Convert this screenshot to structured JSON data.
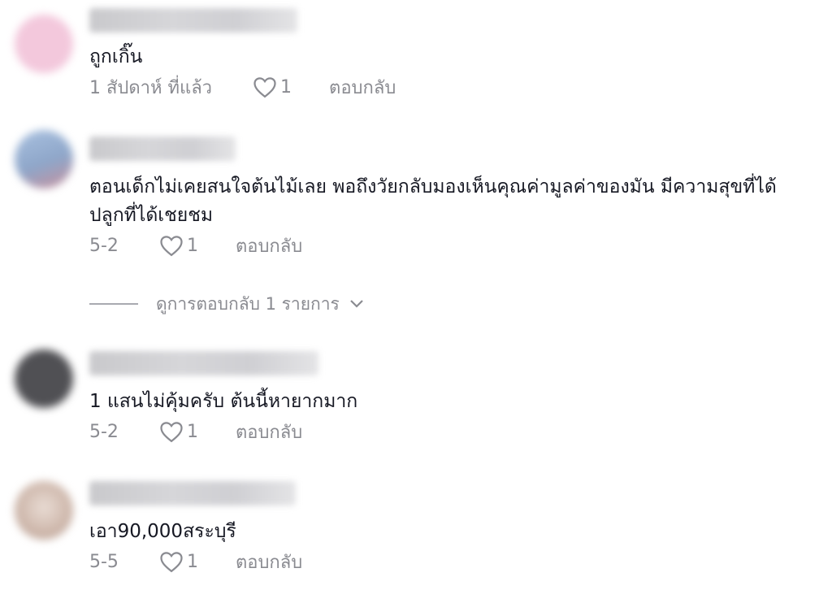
{
  "comments": [
    {
      "text": "ถูกเกิ๊น",
      "time": "1 สัปดาห์ ที่แล้ว",
      "likes": "1",
      "reply_label": "ตอบกลับ",
      "avatar_color": "#f3c8dc"
    },
    {
      "text_line1": "ตอนเด็กไม่เคยสนใจต้นไม้เลย พอถึงวัยกลับมองเห็นคุณค่ามูลค่าของมัน มีความสุขที่ได้",
      "text_line2": "ปลูกที่ได้เชยชม",
      "time": "5-2",
      "likes": "1",
      "reply_label": "ตอบกลับ",
      "avatar_color": "#9fb6d6"
    },
    {
      "text": "1 แสนไม่คุ้มครับ ต้นนี้หายากมาก",
      "time": "5-2",
      "likes": "1",
      "reply_label": "ตอบกลับ",
      "avatar_color": "#5a5a5e"
    },
    {
      "text": "เอา90,000สระบุรี",
      "time": "5-5",
      "likes": "1",
      "reply_label": "ตอบกลับ",
      "avatar_color": "#d8c6bd"
    }
  ],
  "view_replies_label": "ดูการตอบกลับ 1 รายการ",
  "icons": {
    "like": "heart-outline-icon",
    "expand": "chevron-down-icon"
  }
}
